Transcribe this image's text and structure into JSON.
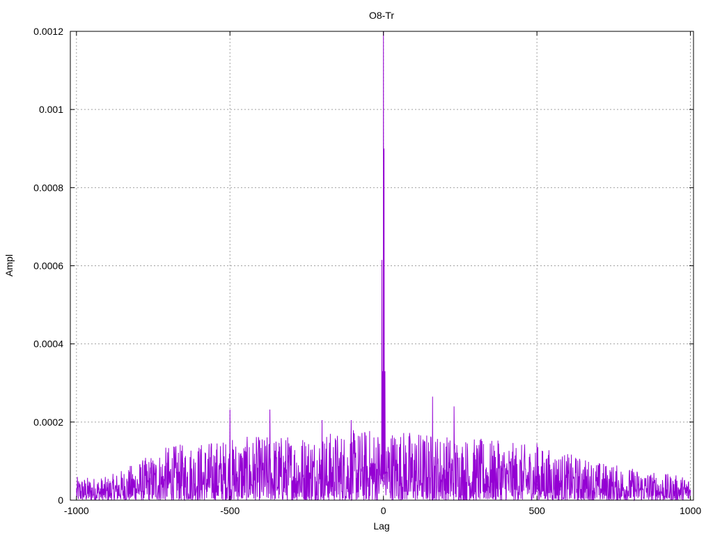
{
  "chart_data": {
    "type": "line",
    "title": "O8-Tr",
    "xlabel": "Lag",
    "ylabel": "Ampl",
    "xlim": [
      -1020,
      1010
    ],
    "ylim": [
      0,
      0.0012
    ],
    "grid": true,
    "x_ticks": [
      -1000,
      -500,
      0,
      500,
      1000
    ],
    "x_tick_labels": [
      "-1000",
      "-500",
      "0",
      "500",
      "1000"
    ],
    "y_ticks": [
      0,
      0.0002,
      0.0004,
      0.0006,
      0.0008,
      0.001,
      0.0012
    ],
    "y_tick_labels": [
      "0",
      "0.0002",
      "0.0004",
      "0.0006",
      "0.0008",
      "0.001",
      "0.0012"
    ],
    "series": [
      {
        "color": "#9400d3",
        "notable_points": [
          {
            "x": -500,
            "y": 0.000232
          },
          {
            "x": -370,
            "y": 0.000232
          },
          {
            "x": -200,
            "y": 0.000205
          },
          {
            "x": -105,
            "y": 0.000205
          },
          {
            "x": -5,
            "y": 0.000615
          },
          {
            "x": -2,
            "y": 0.00033
          },
          {
            "x": 0,
            "y": 0.0012
          },
          {
            "x": 2,
            "y": 0.0009
          },
          {
            "x": 5,
            "y": 0.00033
          },
          {
            "x": 160,
            "y": 0.000265
          },
          {
            "x": 230,
            "y": 0.00024
          },
          {
            "x": 375,
            "y": 0.000145
          },
          {
            "x": 500,
            "y": 0.000145
          }
        ],
        "envelope": [
          {
            "x": -1000,
            "y": 6e-05
          },
          {
            "x": -900,
            "y": 6e-05
          },
          {
            "x": -700,
            "y": 0.00014
          },
          {
            "x": -500,
            "y": 0.00016
          },
          {
            "x": -300,
            "y": 0.00017
          },
          {
            "x": -100,
            "y": 0.00018
          },
          {
            "x": 0,
            "y": 0.00019
          },
          {
            "x": 100,
            "y": 0.00018
          },
          {
            "x": 300,
            "y": 0.00016
          },
          {
            "x": 500,
            "y": 0.00014
          },
          {
            "x": 700,
            "y": 0.0001
          },
          {
            "x": 900,
            "y": 7e-05
          },
          {
            "x": 1000,
            "y": 6e-05
          }
        ]
      }
    ]
  }
}
